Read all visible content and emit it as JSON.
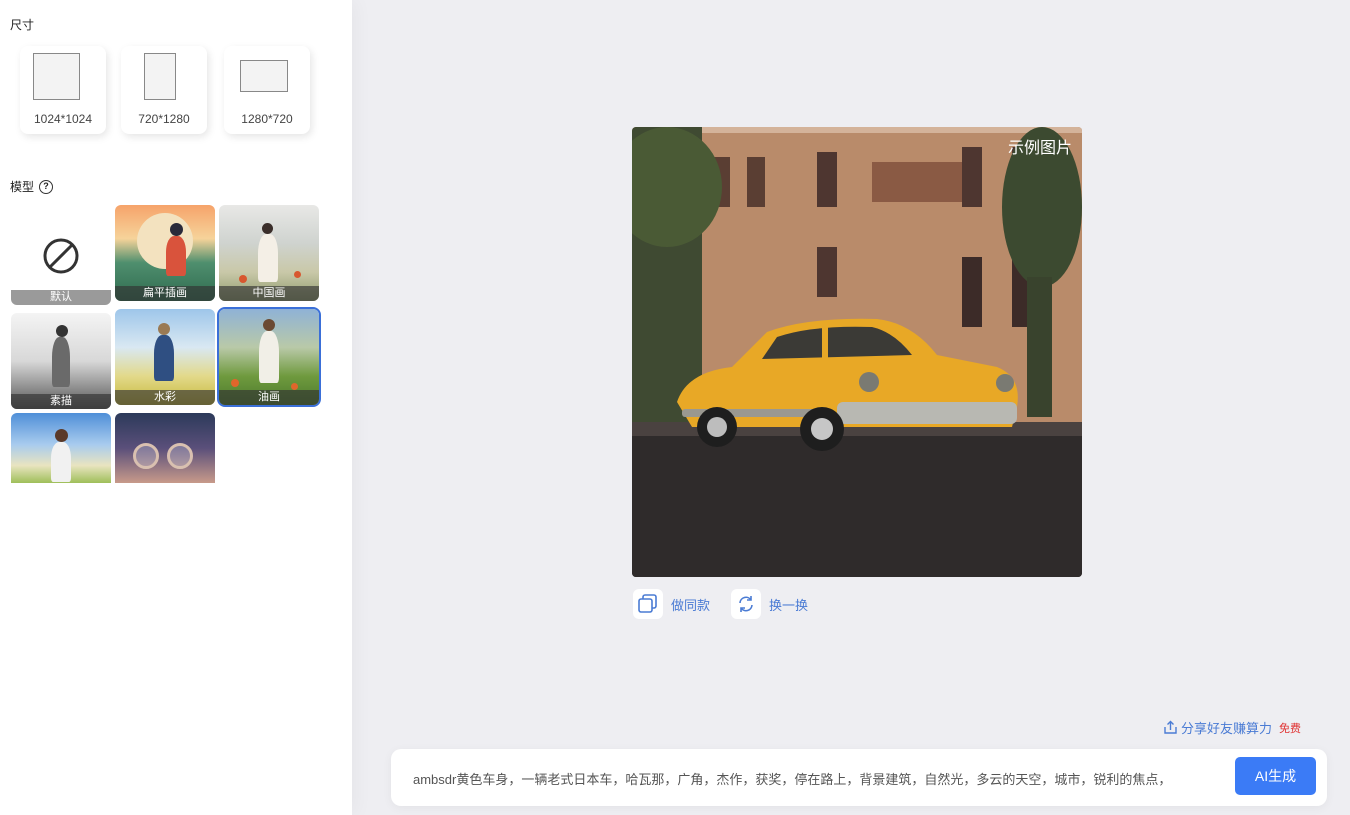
{
  "sidebar": {
    "size_title": "尺寸",
    "sizes": [
      {
        "label": "1024*1024"
      },
      {
        "label": "720*1280"
      },
      {
        "label": "1280*720"
      }
    ],
    "model_title": "模型",
    "help_icon": "?",
    "models": [
      {
        "label": "默认",
        "icon": "ban-icon"
      },
      {
        "label": "扁平插画"
      },
      {
        "label": "中国画"
      },
      {
        "label": "素描"
      },
      {
        "label": "水彩"
      },
      {
        "label": "油画",
        "selected": true
      },
      {
        "label": ""
      },
      {
        "label": ""
      }
    ]
  },
  "preview": {
    "tag": "示例图片"
  },
  "actions": {
    "same_style": "做同款",
    "refresh": "换一换"
  },
  "share": {
    "label": "分享好友赚算力",
    "badge": "免费"
  },
  "prompt": {
    "text": "ambsdr黄色车身，一辆老式日本车，哈瓦那，广角，杰作，获奖，停在路上，背景建筑，自然光，多云的天空，城市，锐利的焦点，",
    "button": "AI生成"
  },
  "colors": {
    "accent": "#3b7bf6",
    "link": "#4a7bd4",
    "badge": "#e03131",
    "car": "#e8a826"
  }
}
